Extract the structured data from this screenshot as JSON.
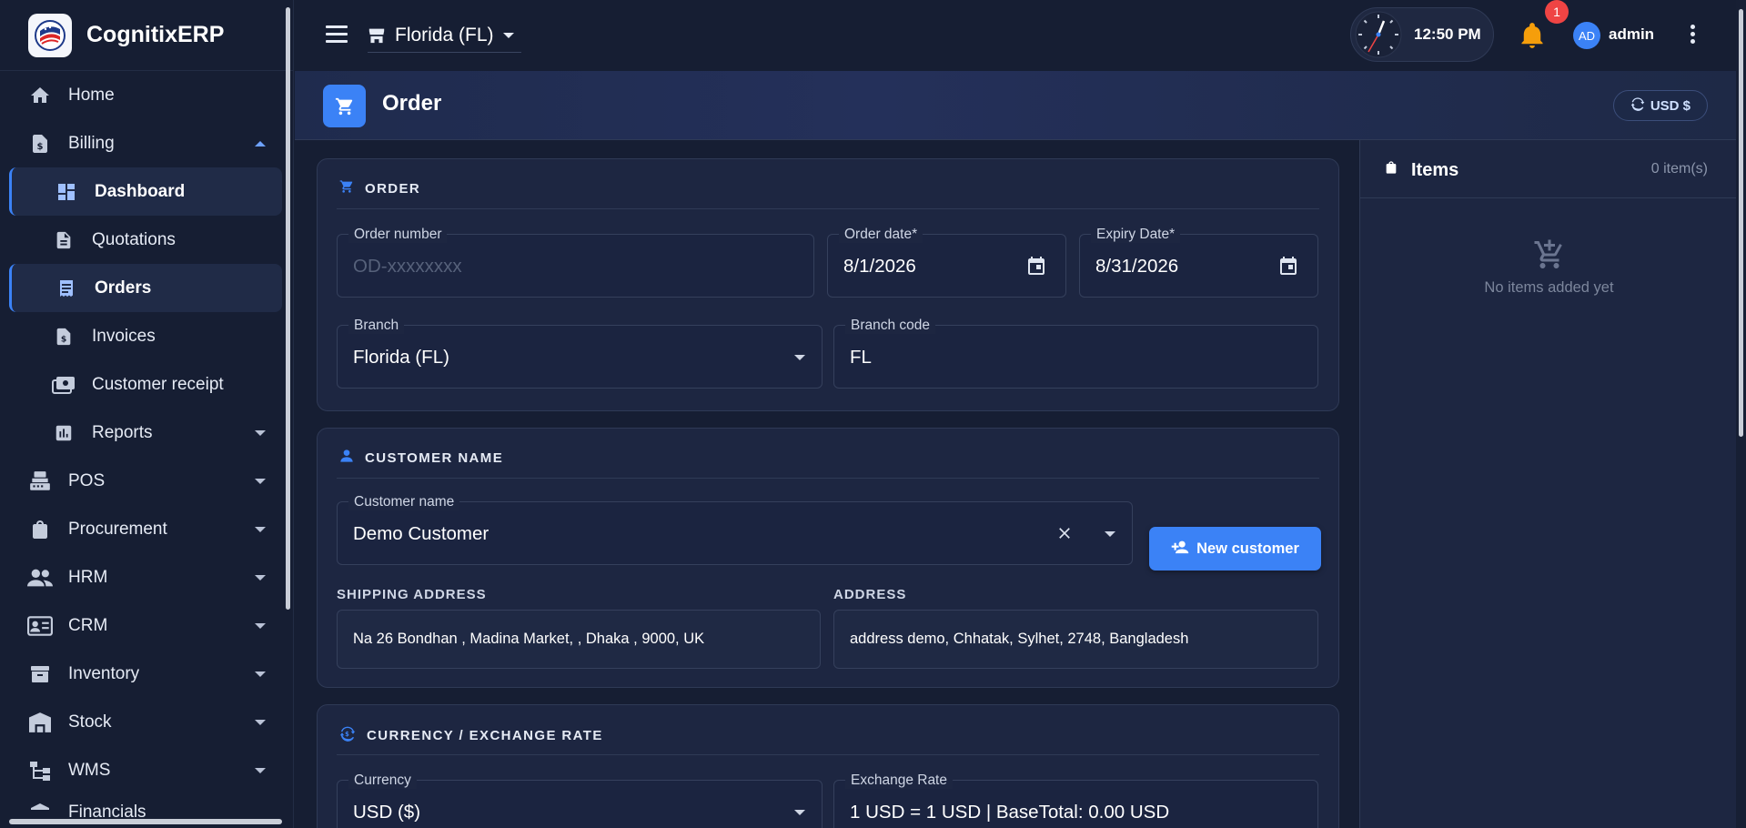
{
  "app": {
    "name": "CognitixERP"
  },
  "sidebar": {
    "items": [
      {
        "label": "Home",
        "icon": "home-icon"
      },
      {
        "label": "Billing",
        "icon": "billing-icon",
        "expanded": true
      },
      {
        "label": "Dashboard",
        "icon": "dashboard-icon"
      },
      {
        "label": "Quotations",
        "icon": "document-icon"
      },
      {
        "label": "Orders",
        "icon": "receipt-icon"
      },
      {
        "label": "Invoices",
        "icon": "invoice-icon"
      },
      {
        "label": "Customer receipt",
        "icon": "payments-icon"
      },
      {
        "label": "Reports",
        "icon": "bar-chart-icon"
      },
      {
        "label": "POS",
        "icon": "pos-icon"
      },
      {
        "label": "Procurement",
        "icon": "shopping-bag-icon"
      },
      {
        "label": "HRM",
        "icon": "people-icon"
      },
      {
        "label": "CRM",
        "icon": "contact-card-icon"
      },
      {
        "label": "Inventory",
        "icon": "archive-icon"
      },
      {
        "label": "Stock",
        "icon": "warehouse-icon"
      },
      {
        "label": "WMS",
        "icon": "hierarchy-icon"
      },
      {
        "label": "Financials",
        "icon": "bank-icon"
      }
    ]
  },
  "header": {
    "branch": "Florida (FL)",
    "time": "12:50 PM",
    "notification_count": "1",
    "avatar_initials": "AD",
    "user": "admin"
  },
  "page": {
    "title": "Order",
    "currency_chip": "USD $"
  },
  "order_section": {
    "title": "ORDER",
    "order_number_label": "Order number",
    "order_number_placeholder": "OD-xxxxxxxx",
    "order_date_label": "Order date*",
    "order_date": "8/1/2026",
    "expiry_date_label": "Expiry Date*",
    "expiry_date": "8/31/2026",
    "branch_label": "Branch",
    "branch_value": "Florida (FL)",
    "branch_code_label": "Branch code",
    "branch_code_value": "FL"
  },
  "customer_section": {
    "title": "CUSTOMER NAME",
    "customer_label": "Customer name",
    "customer_value": "Demo Customer",
    "new_customer_button": "New customer",
    "shipping_label": "SHIPPING ADDRESS",
    "shipping_value": "Na 26 Bondhan , Madina Market, , Dhaka , 9000, UK",
    "address_label": "ADDRESS",
    "address_value": "address demo, Chhatak, Sylhet, 2748, Bangladesh"
  },
  "currency_section": {
    "title": "CURRENCY / EXCHANGE RATE",
    "currency_label": "Currency",
    "currency_value": "USD ($)",
    "exchange_label": "Exchange Rate",
    "exchange_value": "1 USD = 1 USD | BaseTotal: 0.00 USD"
  },
  "items_panel": {
    "title": "Items",
    "count": "0 item(s)",
    "empty_message": "No items added yet"
  },
  "colors": {
    "background": "#161e33",
    "card": "#1d2641",
    "accent": "#3b82f6",
    "badge": "#ef4444",
    "bell": "#f59e0b"
  }
}
